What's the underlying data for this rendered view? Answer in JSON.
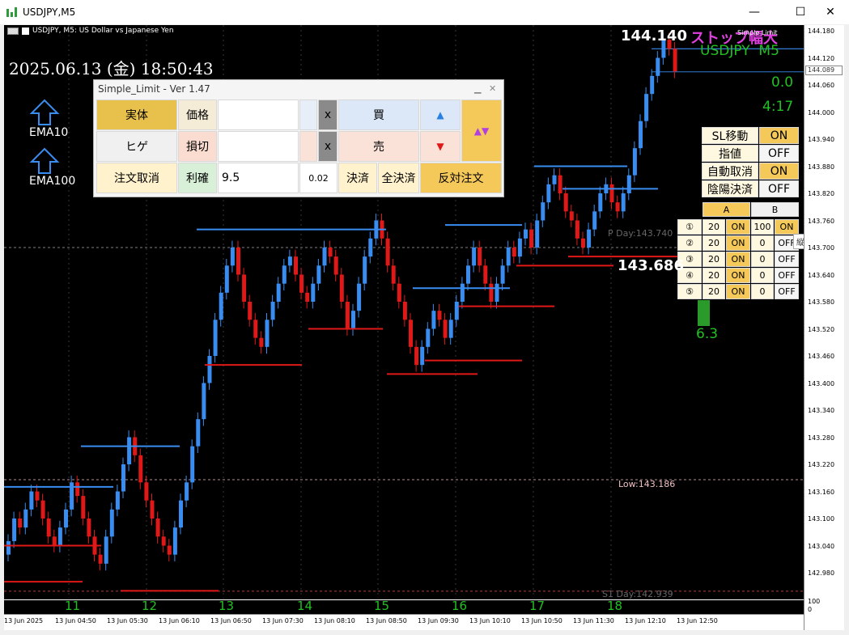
{
  "window": {
    "title": "USDJPY,M5",
    "minimize": "—",
    "maximize": "☐",
    "close": "✕"
  },
  "chart": {
    "header": "USDJPY, M5:  US Dollar vs Japanese Yen",
    "datetime": "2025.06.13 (金) 18:50:43",
    "ema10": "EMA10",
    "ema100": "EMA100",
    "big_price_top": "144.140",
    "stop_label": "ストップ幅大",
    "simple_limit_label": "Simple Limit",
    "symbol": "USDJPY",
    "timeframe": "M5",
    "pnl": "0.0",
    "countdown": "4:17",
    "bid_price": "143.686",
    "pday": "P Day:143.740",
    "low": "Low:143.186",
    "s1day": "S1 Day:142.939",
    "spread": "6.3",
    "tooltip": "縦軸スケール",
    "current_price_box": "144.089",
    "price_ticks": [
      "144.180",
      "144.120",
      "144.060",
      "144.000",
      "143.940",
      "143.880",
      "143.820",
      "143.760",
      "143.700",
      "143.640",
      "143.580",
      "143.520",
      "143.460",
      "143.400",
      "143.340",
      "143.280",
      "143.220",
      "143.160",
      "143.100",
      "143.040",
      "142.980"
    ],
    "sub_ticks": [
      "100",
      "0"
    ],
    "hour_labels": [
      "11",
      "12",
      "13",
      "14",
      "15",
      "16",
      "17",
      "18"
    ],
    "time_ticks": [
      "13 Jun 2025",
      "13 Jun 04:50",
      "13 Jun 05:30",
      "13 Jun 06:10",
      "13 Jun 06:50",
      "13 Jun 07:30",
      "13 Jun 08:10",
      "13 Jun 08:50",
      "13 Jun 09:30",
      "13 Jun 10:10",
      "13 Jun 10:50",
      "13 Jun 11:30",
      "13 Jun 12:10",
      "13 Jun 12:50"
    ]
  },
  "panel": {
    "title": "Simple_Limit - Ver 1.47",
    "body_btn": "実体",
    "price_label": "価格",
    "x1": "x",
    "buy": "買",
    "wick_btn": "ヒゲ",
    "stoploss_label": "損切",
    "x2": "x",
    "sell": "売",
    "cancel_orders": "注文取消",
    "takeprofit_label": "利確",
    "takeprofit_value": "9.5",
    "lot": "0.02",
    "settle": "決済",
    "settle_all": "全決済",
    "reverse": "反対注文",
    "up_arrow": "▲",
    "down_arrow": "▼",
    "updown": "▲▼"
  },
  "settings": [
    {
      "label": "SL移動",
      "value": "ON"
    },
    {
      "label": "指値",
      "value": "OFF"
    },
    {
      "label": "自動取消",
      "value": "ON"
    },
    {
      "label": "陰陽決済",
      "value": "OFF"
    }
  ],
  "mini_table": {
    "col_a": "A",
    "col_b": "B",
    "rows": [
      {
        "n": "①",
        "a": "20",
        "a_state": "ON",
        "b": "100",
        "b_state": "ON"
      },
      {
        "n": "②",
        "a": "20",
        "a_state": "ON",
        "b": "0",
        "b_state": "OFF"
      },
      {
        "n": "③",
        "a": "20",
        "a_state": "ON",
        "b": "0",
        "b_state": "OFF"
      },
      {
        "n": "④",
        "a": "20",
        "a_state": "ON",
        "b": "0",
        "b_state": "OFF"
      },
      {
        "n": "⑤",
        "a": "20",
        "a_state": "ON",
        "b": "0",
        "b_state": "OFF"
      }
    ]
  },
  "colors": {
    "bull": "#3a8df0",
    "bear": "#e01818",
    "on": "#f5c85a",
    "background": "#000000"
  }
}
